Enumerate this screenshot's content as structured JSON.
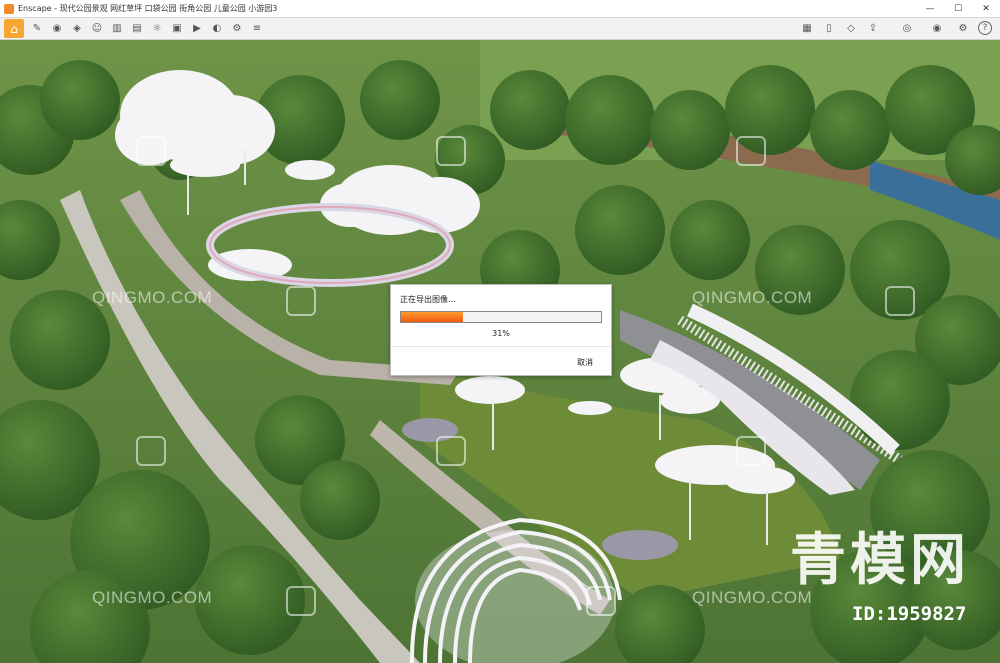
{
  "window": {
    "title": "Enscape - 现代公园景观 网红草坪 口袋公园 街角公园 儿童公园 小游园3",
    "minimize": "—",
    "maximize": "☐",
    "close": "✕"
  },
  "toolbar": {
    "icons_left": [
      "home-icon",
      "brush-icon",
      "camera-icon",
      "pin-icon",
      "person-icon",
      "building-icon",
      "gallery-icon",
      "lamp-icon",
      "image-icon",
      "video-icon",
      "panorama-icon",
      "settings-icon",
      "layers-icon"
    ],
    "icons_right": [
      "gallery-icon",
      "book-icon",
      "cube-icon",
      "share-icon",
      "vr-icon",
      "eye-icon",
      "gear-icon",
      "help-icon"
    ],
    "help": "?"
  },
  "export_dialog": {
    "title": "正在导出图像...",
    "progress": 0.31,
    "percent_text": "31%",
    "cancel_label": "取消",
    "bar_color": "#f26b12"
  },
  "watermarks": {
    "site_text": "QINGMO.COM",
    "brand": "青模网",
    "id_text": "ID:1959827"
  }
}
